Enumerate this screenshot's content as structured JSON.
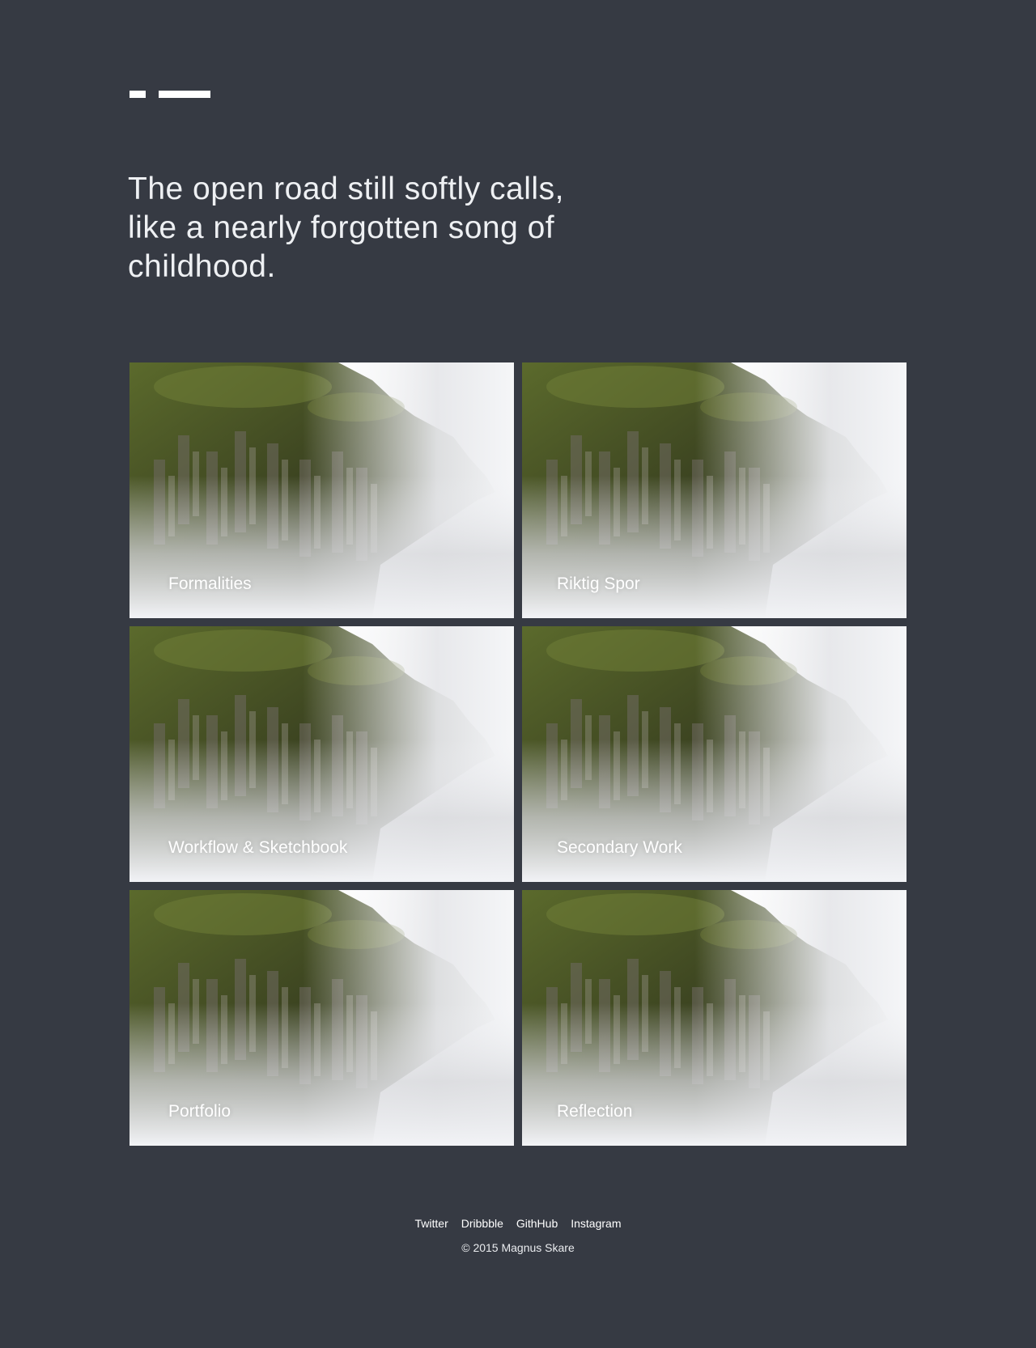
{
  "header": {
    "logo_icon": "logo-bars-icon",
    "headline": "The open road still softly calls, like a nearly forgotten song of childhood."
  },
  "projects": [
    {
      "title": "Formalities"
    },
    {
      "title": "Riktig Spor"
    },
    {
      "title": "Workflow & Sketchbook"
    },
    {
      "title": "Secondary Work"
    },
    {
      "title": "Portfolio"
    },
    {
      "title": "Reflection"
    }
  ],
  "footer": {
    "links": [
      "Twitter",
      "Dribbble",
      "GithHub",
      "Instagram"
    ],
    "copyright": "© 2015 Magnus Skare"
  },
  "colors": {
    "background": "#363a43",
    "text": "#ffffff",
    "mist": "#f2f3f6",
    "foliage": "#5b6a2c",
    "rock": "#6f6a62"
  }
}
